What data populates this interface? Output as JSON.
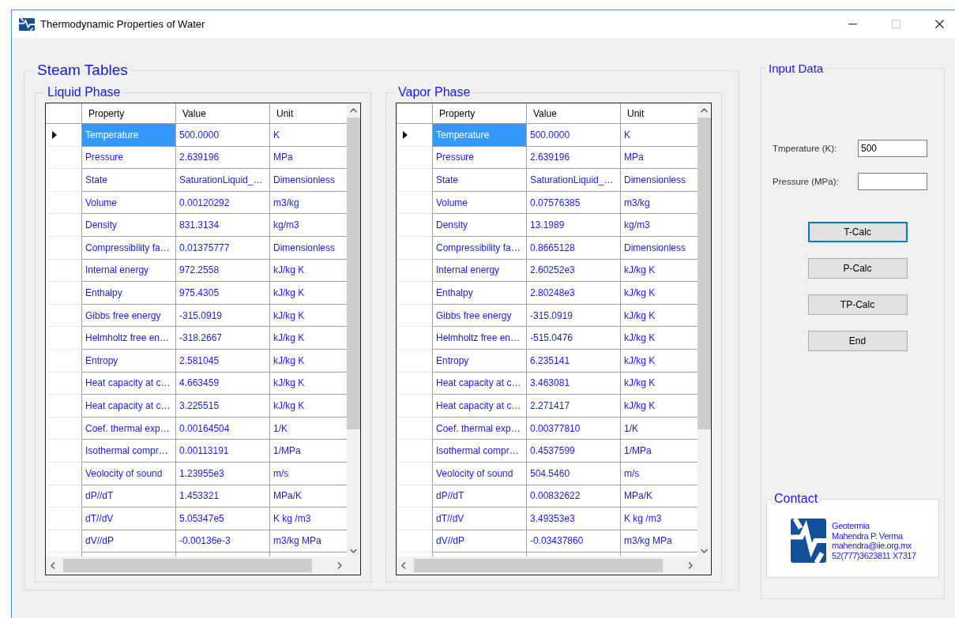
{
  "window": {
    "title": "Thermodynamic Properties of Water"
  },
  "titlebar_buttons": [
    {
      "kind": "minimize",
      "disabled": false
    },
    {
      "kind": "maximize",
      "disabled": true
    },
    {
      "kind": "close",
      "disabled": false
    }
  ],
  "steam_tables": {
    "title": "Steam Tables",
    "phases": [
      {
        "title": "Liquid Phase",
        "table": {
          "columns": [
            "Property",
            "Value",
            "Unit"
          ],
          "rows": [
            {
              "property": "Temperature",
              "value": "500.0000",
              "unit": "K",
              "selected": true
            },
            {
              "property": "Pressure",
              "value": "2.639196",
              "unit": "MPa",
              "selected": false
            },
            {
              "property": "State",
              "value": "SaturationLiquid_…",
              "unit": "Dimensionless",
              "selected": false
            },
            {
              "property": "Volume",
              "value": "0.00120292",
              "unit": "m3/kg",
              "selected": false
            },
            {
              "property": "Density",
              "value": "831.3134",
              "unit": "kg/m3",
              "selected": false
            },
            {
              "property": "Compressibility fa…",
              "value": "0.01375777",
              "unit": "Dimensionless",
              "selected": false
            },
            {
              "property": "Internal energy",
              "value": "972.2558",
              "unit": "kJ/kg K",
              "selected": false
            },
            {
              "property": "Enthalpy",
              "value": "975.4305",
              "unit": "kJ/kg K",
              "selected": false
            },
            {
              "property": "Gibbs free energy",
              "value": "-315.0919",
              "unit": "kJ/kg K",
              "selected": false
            },
            {
              "property": "Helmholtz free en…",
              "value": "-318.2667",
              "unit": "kJ/kg K",
              "selected": false
            },
            {
              "property": "Entropy",
              "value": "2.581045",
              "unit": "kJ/kg K",
              "selected": false
            },
            {
              "property": "Heat capacity at c…",
              "value": "4.663459",
              "unit": "kJ/kg K",
              "selected": false
            },
            {
              "property": "Heat capacity at c…",
              "value": "3.225515",
              "unit": "kJ/kg K",
              "selected": false
            },
            {
              "property": "Coef. thermal exp…",
              "value": "0.00164504",
              "unit": "1/K",
              "selected": false
            },
            {
              "property": "Isothermal compr…",
              "value": "0.00113191",
              "unit": "1/MPa",
              "selected": false
            },
            {
              "property": "Veolocity of sound",
              "value": "1.23955e3",
              "unit": "m/s",
              "selected": false
            },
            {
              "property": "dP//dT",
              "value": "1.453321",
              "unit": "MPa/K",
              "selected": false
            },
            {
              "property": "dT//dV",
              "value": "5.05347e5",
              "unit": "K kg /m3",
              "selected": false
            },
            {
              "property": "dV//dP",
              "value": "-0.00136e-3",
              "unit": "m3/kg MPa",
              "selected": false
            }
          ]
        }
      },
      {
        "title": "Vapor Phase",
        "table": {
          "columns": [
            "Property",
            "Value",
            "Unit"
          ],
          "rows": [
            {
              "property": "Temperature",
              "value": "500.0000",
              "unit": "K",
              "selected": true
            },
            {
              "property": "Pressure",
              "value": "2.639196",
              "unit": "MPa",
              "selected": false
            },
            {
              "property": "State",
              "value": "SaturationLiquid_…",
              "unit": "Dimensionless",
              "selected": false
            },
            {
              "property": "Volume",
              "value": "0.07576385",
              "unit": "m3/kg",
              "selected": false
            },
            {
              "property": "Density",
              "value": "13.1989",
              "unit": "kg/m3",
              "selected": false
            },
            {
              "property": "Compressibility fa…",
              "value": "0.8665128",
              "unit": "Dimensionless",
              "selected": false
            },
            {
              "property": "Internal energy",
              "value": "2.60252e3",
              "unit": "kJ/kg K",
              "selected": false
            },
            {
              "property": "Enthalpy",
              "value": "2.80248e3",
              "unit": "kJ/kg K",
              "selected": false
            },
            {
              "property": "Gibbs free energy",
              "value": "-315.0919",
              "unit": "kJ/kg K",
              "selected": false
            },
            {
              "property": "Helmholtz free en…",
              "value": "-515.0476",
              "unit": "kJ/kg K",
              "selected": false
            },
            {
              "property": "Entropy",
              "value": "6.235141",
              "unit": "kJ/kg K",
              "selected": false
            },
            {
              "property": "Heat capacity at c…",
              "value": "3.463081",
              "unit": "kJ/kg K",
              "selected": false
            },
            {
              "property": "Heat capacity at c…",
              "value": "2.271417",
              "unit": "kJ/kg K",
              "selected": false
            },
            {
              "property": "Coef. thermal exp…",
              "value": "0.00377810",
              "unit": "1/K",
              "selected": false
            },
            {
              "property": "Isothermal compr…",
              "value": "0.4537599",
              "unit": "1/MPa",
              "selected": false
            },
            {
              "property": "Veolocity of sound",
              "value": "504.5460",
              "unit": "m/s",
              "selected": false
            },
            {
              "property": "dP//dT",
              "value": "0.00832622",
              "unit": "MPa/K",
              "selected": false
            },
            {
              "property": "dT//dV",
              "value": "3.49353e3",
              "unit": "K kg /m3",
              "selected": false
            },
            {
              "property": "dV//dP",
              "value": "-0.03437860",
              "unit": "m3/kg MPa",
              "selected": false
            }
          ]
        }
      }
    ]
  },
  "input_data": {
    "title": "Input Data",
    "fields": [
      {
        "label": "Tmperature (K):",
        "value": "500"
      },
      {
        "label": "Pressure (MPa):"
      }
    ],
    "buttons": [
      {
        "label": "T-Calc",
        "focused": true
      },
      {
        "label": "P-Calc",
        "focused": false
      },
      {
        "label": "TP-Calc",
        "focused": false
      },
      {
        "label": "End",
        "focused": false
      }
    ],
    "contact": {
      "title": "Contact",
      "lines": [
        "Geotermia",
        "Mahendra P. Verma",
        "mahendra@iie.org.mx",
        "52(777)3623811 X7317"
      ]
    }
  }
}
